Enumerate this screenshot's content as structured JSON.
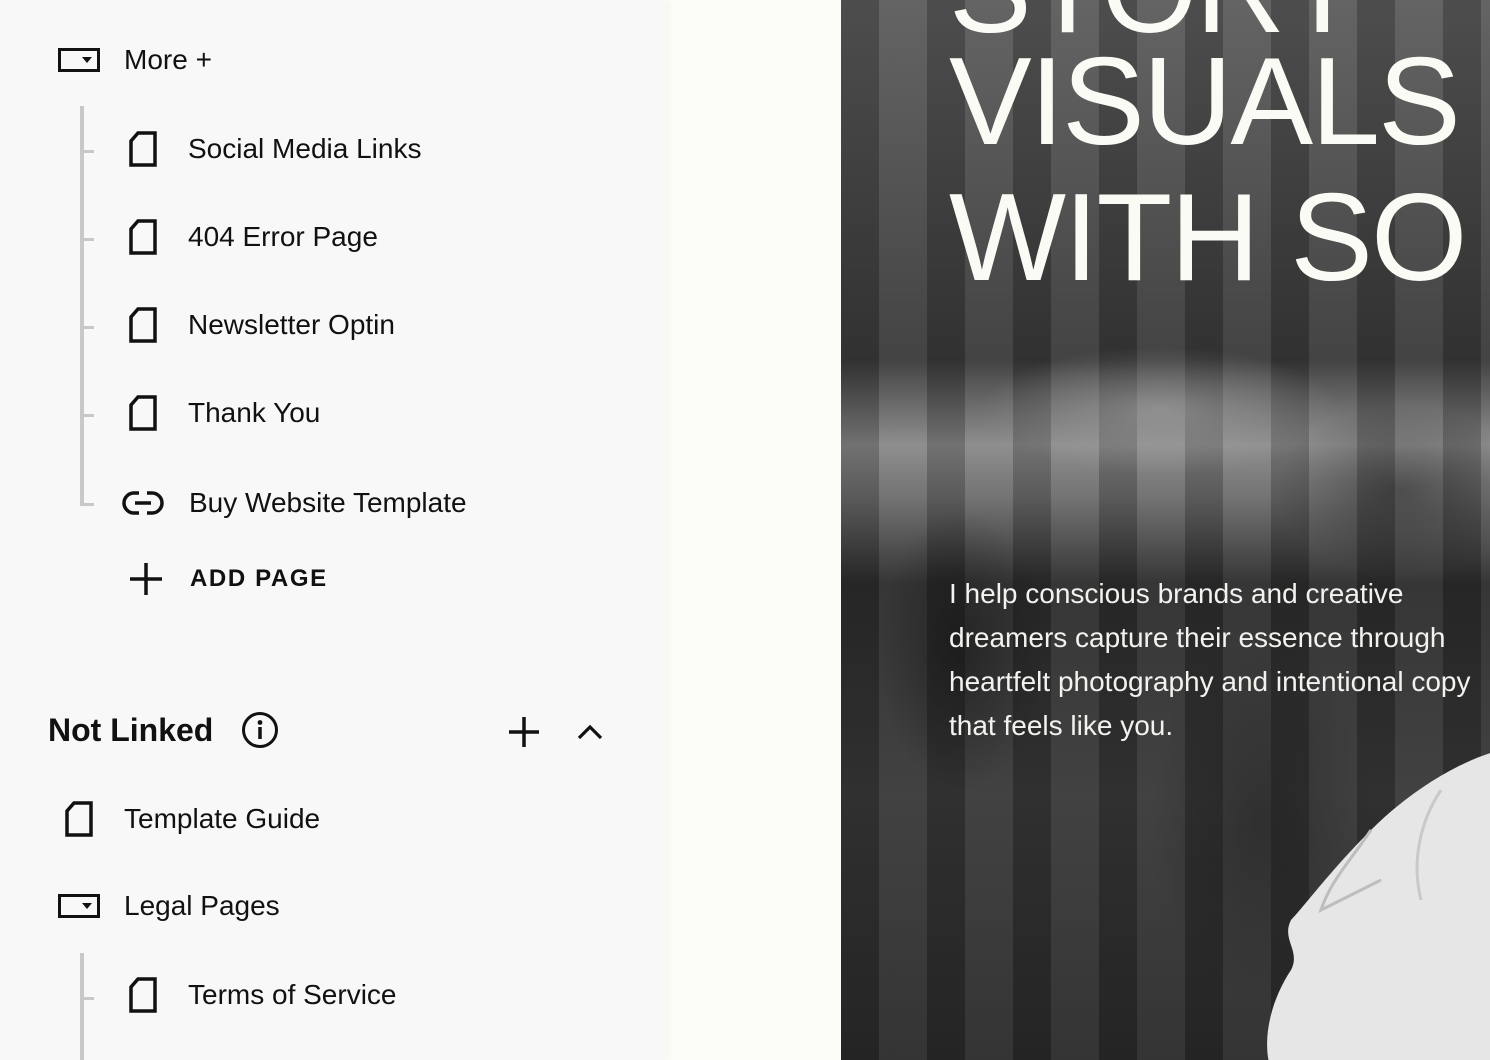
{
  "sidebar": {
    "more_folder": {
      "label": "More +",
      "icon": "folder-icon"
    },
    "more_children": [
      {
        "label": "Social Media Links",
        "icon": "page-icon"
      },
      {
        "label": "404 Error Page",
        "icon": "page-icon"
      },
      {
        "label": "Newsletter Optin",
        "icon": "page-icon"
      },
      {
        "label": "Thank You",
        "icon": "page-icon"
      },
      {
        "label": "Buy Website Template",
        "icon": "link-icon"
      }
    ],
    "add_page_label": "ADD PAGE",
    "not_linked": {
      "title": "Not Linked",
      "info_icon": "info-icon",
      "add_icon": "plus-icon",
      "collapse_icon": "chevron-up-icon",
      "items": [
        {
          "label": "Template Guide",
          "icon": "page-icon"
        },
        {
          "label": "Legal Pages",
          "icon": "folder-icon"
        }
      ],
      "legal_children": [
        {
          "label": "Terms of Service",
          "icon": "page-icon"
        }
      ]
    }
  },
  "preview": {
    "headline_lines": [
      "STORY",
      "VISUALS",
      "WITH SO"
    ],
    "body_text": "I help conscious brands and creative dreamers capture their essence through heartfelt photography and intentional copy that feels like you."
  },
  "colors": {
    "panel_bg": "#f8f8f8",
    "tree_line": "#c8c8c8",
    "text": "#111111",
    "hero_text": "#fbfbf6"
  }
}
